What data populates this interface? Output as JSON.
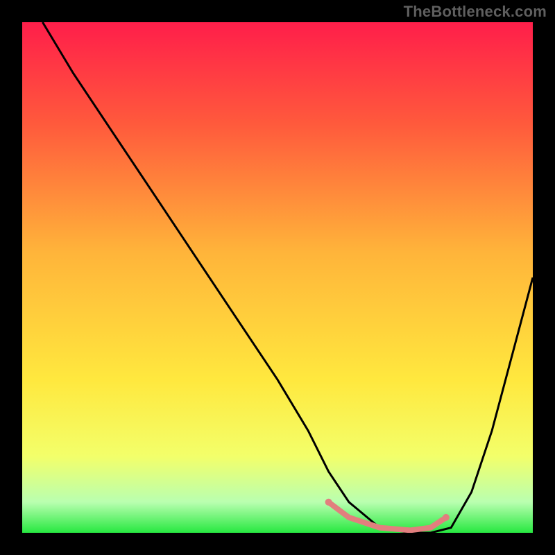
{
  "watermark": "TheBottleneck.com",
  "chart_data": {
    "type": "line",
    "title": "",
    "xlabel": "",
    "ylabel": "",
    "xlim": [
      0,
      100
    ],
    "ylim": [
      0,
      100
    ],
    "grid": false,
    "legend": false,
    "gradient_stops": [
      {
        "offset": 0,
        "color": "#ff1e4a"
      },
      {
        "offset": 20,
        "color": "#ff5a3c"
      },
      {
        "offset": 45,
        "color": "#ffb43a"
      },
      {
        "offset": 70,
        "color": "#ffe83e"
      },
      {
        "offset": 85,
        "color": "#f3ff6a"
      },
      {
        "offset": 94,
        "color": "#b9ffb0"
      },
      {
        "offset": 100,
        "color": "#27e840"
      }
    ],
    "series": [
      {
        "name": "curve",
        "stroke": "#000000",
        "stroke_width": 3,
        "x": [
          4,
          10,
          18,
          26,
          34,
          42,
          50,
          56,
          60,
          64,
          70,
          76,
          80,
          84,
          88,
          92,
          96,
          100
        ],
        "y": [
          100,
          90,
          78,
          66,
          54,
          42,
          30,
          20,
          12,
          6,
          1,
          0,
          0,
          1,
          8,
          20,
          35,
          50
        ]
      },
      {
        "name": "highlight-band",
        "stroke": "#e27f7e",
        "stroke_width": 8,
        "x": [
          60,
          64,
          70,
          76,
          80,
          83
        ],
        "y": [
          6,
          3,
          1,
          0.5,
          1,
          3
        ]
      }
    ],
    "end_dots": [
      {
        "x": 60,
        "y": 6,
        "r": 5,
        "color": "#e27f7e"
      },
      {
        "x": 83,
        "y": 3,
        "r": 5,
        "color": "#e27f7e"
      }
    ]
  }
}
